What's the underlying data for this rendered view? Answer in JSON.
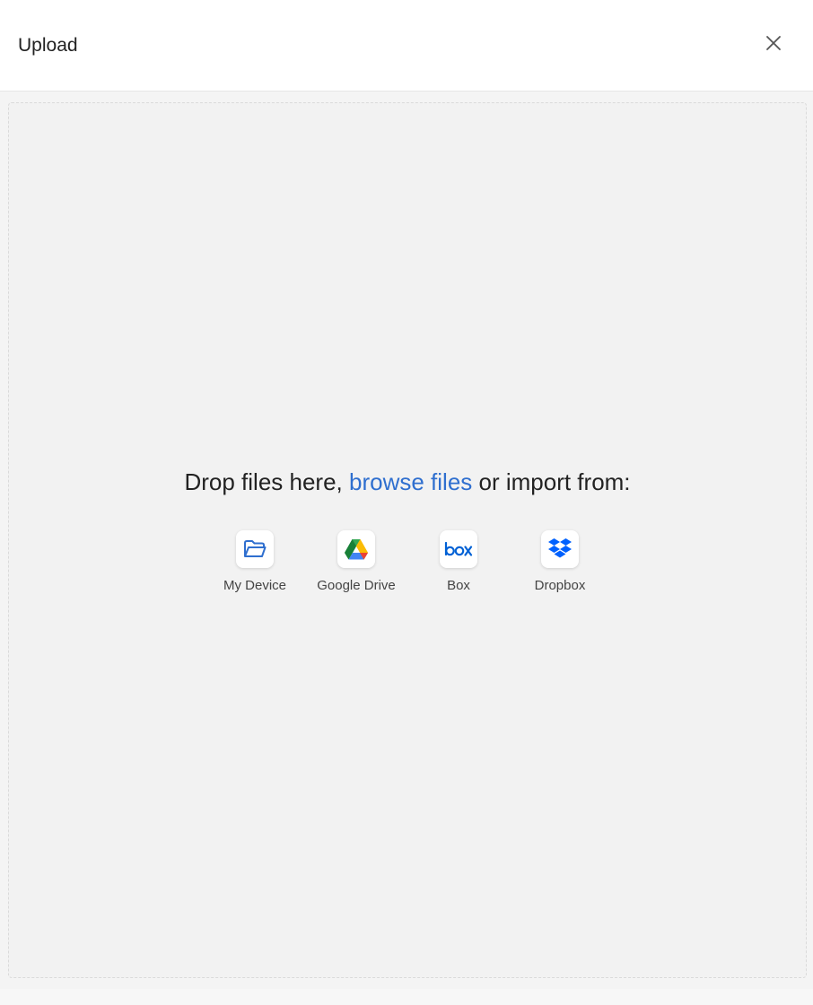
{
  "header": {
    "title": "Upload",
    "close_icon": "close-icon"
  },
  "dropzone": {
    "prefix": "Drop files here, ",
    "browse_link": "browse files",
    "suffix": " or import from:"
  },
  "sources": [
    {
      "label": "My Device",
      "icon": "folder-icon",
      "color": "#2f6fcf"
    },
    {
      "label": "Google Drive",
      "icon": "google-drive-icon",
      "color": "#1fa463"
    },
    {
      "label": "Box",
      "icon": "box-icon",
      "color": "#0061d5"
    },
    {
      "label": "Dropbox",
      "icon": "dropbox-icon",
      "color": "#0061fe"
    }
  ],
  "colors": {
    "link": "#2f6fcf",
    "background": "#f2f2f2"
  }
}
